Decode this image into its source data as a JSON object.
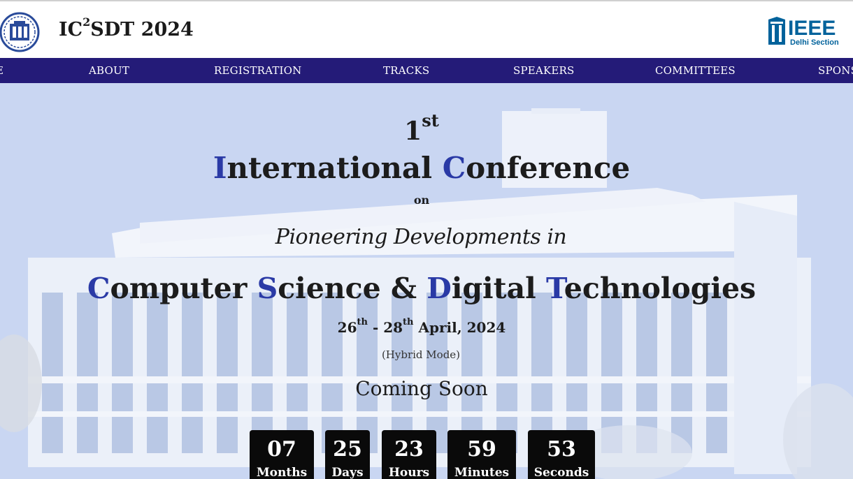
{
  "header": {
    "title_main": "IC",
    "title_sup": "2",
    "title_rest": "SDT 2024",
    "ieee_text": "IEEE",
    "ieee_subtext": "Delhi Section"
  },
  "nav": {
    "items": [
      "E",
      "ABOUT",
      "REGISTRATION",
      "TRACKS",
      "SPEAKERS",
      "COMMITTEES",
      "SPONS"
    ]
  },
  "hero": {
    "ordinal_num": "1",
    "ordinal_suffix": "st",
    "conf_i": "I",
    "conf_rest1": "nternational ",
    "conf_c": "C",
    "conf_rest2": "onference",
    "on": "on",
    "pioneering": "Pioneering Developments in",
    "cs_c": "C",
    "cs_rest1": "omputer ",
    "cs_s": "S",
    "cs_rest2": "cience & ",
    "cs_d": "D",
    "cs_rest3": "igital ",
    "cs_t": "T",
    "cs_rest4": "echnologies",
    "date_start": "26",
    "date_start_suffix": "th",
    "date_sep": " - 28",
    "date_end_suffix": "th",
    "date_rest": " April, 2024",
    "mode": "(Hybrid Mode)",
    "coming_soon": "Coming Soon"
  },
  "countdown": [
    {
      "value": "07",
      "label": "Months"
    },
    {
      "value": "25",
      "label": "Days"
    },
    {
      "value": "23",
      "label": "Hours"
    },
    {
      "value": "59",
      "label": "Minutes"
    },
    {
      "value": "53",
      "label": "Seconds"
    }
  ],
  "colors": {
    "nav_bg": "#241b78",
    "accent_letter": "#2a3aa6",
    "ieee_blue": "#00629b"
  }
}
